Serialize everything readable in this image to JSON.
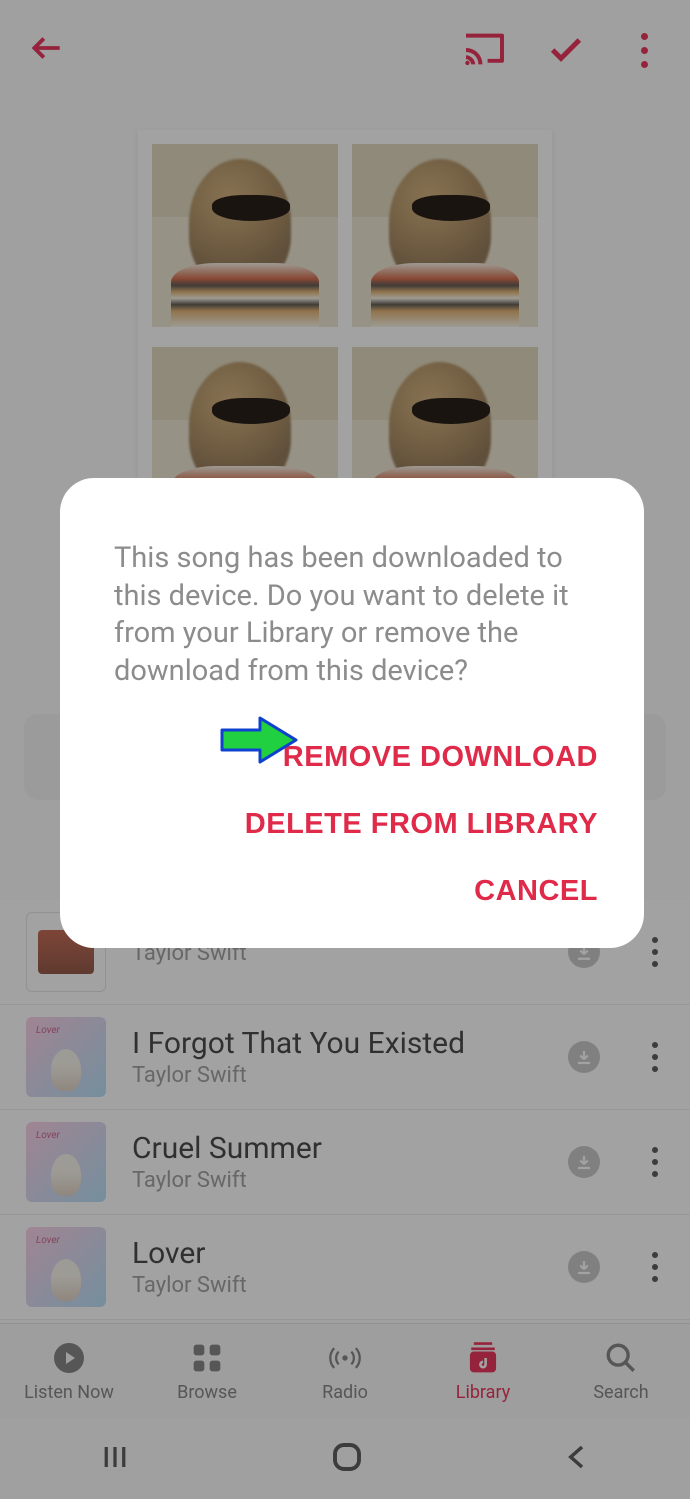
{
  "topbar": {
    "back_icon": "back",
    "cast_icon": "cast",
    "check_icon": "check",
    "more_icon": "more"
  },
  "dialog": {
    "message": "This song has been downloaded to this device. Do you want to delete it from your Library or remove the download from this device?",
    "actions": {
      "remove_download": "REMOVE DOWNLOAD",
      "delete_from_library": "DELETE FROM LIBRARY",
      "cancel": "CANCEL"
    }
  },
  "songs": [
    {
      "title": "",
      "artist": "Taylor Swift"
    },
    {
      "title": "I Forgot That You Existed",
      "artist": "Taylor Swift"
    },
    {
      "title": "Cruel Summer",
      "artist": "Taylor Swift"
    },
    {
      "title": "Lover",
      "artist": "Taylor Swift"
    }
  ],
  "tabs": {
    "listen_now": "Listen Now",
    "browse": "Browse",
    "radio": "Radio",
    "library": "Library",
    "search": "Search",
    "active": "library"
  },
  "colors": {
    "accent": "#e60033",
    "dialog_action": "#e02a4a",
    "arrow": "#20d040"
  }
}
